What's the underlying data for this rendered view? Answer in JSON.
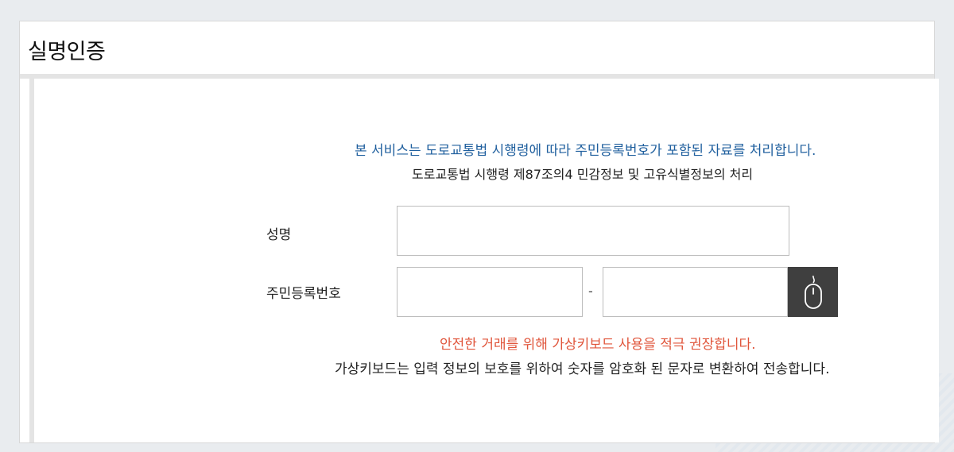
{
  "page": {
    "title": "실명인증"
  },
  "notices": {
    "service_notice": "본 서비스는 도로교통법 시행령에 따라 주민등록번호가 포함된 자료를 처리합니다.",
    "law_reference": "도로교통법 시행령 제87조의4 민감정보 및 고유식별정보의 처리",
    "keyboard_recommend": "안전한 거래를 위해 가상키보드 사용을 적극 권장합니다.",
    "keyboard_explain": "가상키보드는 입력 정보의 보호를 위하여 숫자를 암호화 된 문자로 변환하여 전송합니다."
  },
  "form": {
    "name_label": "성명",
    "name_value": "",
    "rrn_label": "주민등록번호",
    "rrn_front_value": "",
    "rrn_back_value": "",
    "rrn_separator": "-",
    "virtual_keyboard_icon": "mouse-icon"
  },
  "colors": {
    "service_notice": "#1f5f9e",
    "keyboard_recommend": "#e0553b",
    "virtual_keyboard_button": "#3f3f3f"
  }
}
